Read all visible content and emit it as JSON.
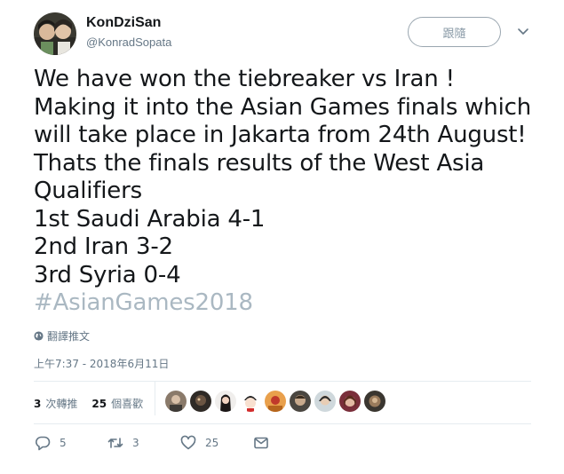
{
  "user": {
    "name": "KonDziSan",
    "handle": "@KonradSopata"
  },
  "follow_label": "跟隨",
  "tweet": {
    "lines": [
      "We have won the tiebreaker vs Iran !",
      "Making it into the Asian Games finals which",
      "will take place in Jakarta from 24th August!",
      "Thats the finals results of the West Asia",
      "Qualifiers",
      "1st Saudi Arabia 4-1",
      "2nd Iran 3-2",
      "3rd Syria 0-4"
    ],
    "hashtag": "#AsianGames2018"
  },
  "translate_label": "翻譯推文",
  "timestamp": "上午7:37 - 2018年6月11日",
  "stats": {
    "retweets_count": "3",
    "retweets_label": "次轉推",
    "likes_count": "25",
    "likes_label": "個喜歡"
  },
  "actions": {
    "reply_count": "5",
    "retweet_count": "3",
    "like_count": "25"
  },
  "colors": {
    "text": "#14171a",
    "muted": "#657786",
    "hashtag": "#aab8c2",
    "divider": "#e6ecf0"
  }
}
